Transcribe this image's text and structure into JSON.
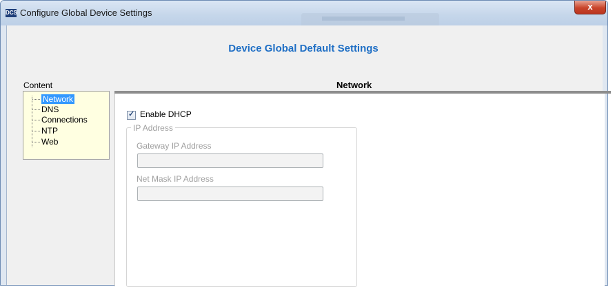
{
  "window": {
    "title": "Configure Global Device Settings",
    "app_icon_text": "DCS",
    "close_glyph": "x"
  },
  "header": {
    "title": "Device Global Default Settings"
  },
  "content": {
    "label": "Content",
    "items": [
      {
        "label": "Network",
        "selected": true
      },
      {
        "label": "DNS",
        "selected": false
      },
      {
        "label": "Connections",
        "selected": false
      },
      {
        "label": "NTP",
        "selected": false
      },
      {
        "label": "Web",
        "selected": false
      }
    ]
  },
  "network": {
    "title": "Network",
    "dhcp_label": "Enable DHCP",
    "dhcp_checked": true,
    "ip_group_label": "IP Address",
    "gateway_label": "Gateway IP Address",
    "gateway_value": "",
    "netmask_label": "Net Mask IP Address",
    "netmask_value": ""
  },
  "colors": {
    "accent": "#1f6fc5",
    "selection": "#3399ff",
    "tree_background": "#ffffe1"
  }
}
